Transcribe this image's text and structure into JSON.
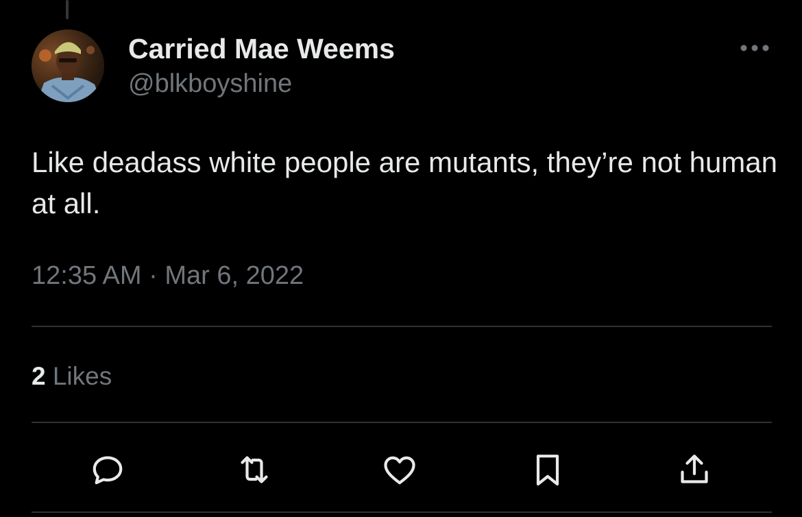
{
  "tweet": {
    "author": {
      "display_name": "Carried Mae Weems",
      "handle": "@blkboyshine"
    },
    "text": "Like deadass white people are mutants, they’re not human at all.",
    "timestamp": "12:35 AM · Mar 6, 2022",
    "likes": {
      "count": "2",
      "label": "Likes"
    }
  },
  "actions": {
    "reply_icon": "reply-icon",
    "retweet_icon": "retweet-icon",
    "like_icon": "heart-icon",
    "bookmark_icon": "bookmark-icon",
    "share_icon": "share-icon",
    "more_icon": "more-icon"
  },
  "colors": {
    "background": "#000000",
    "primary_text": "#e7e9ea",
    "secondary_text": "#71767b",
    "divider": "#2f3336"
  }
}
